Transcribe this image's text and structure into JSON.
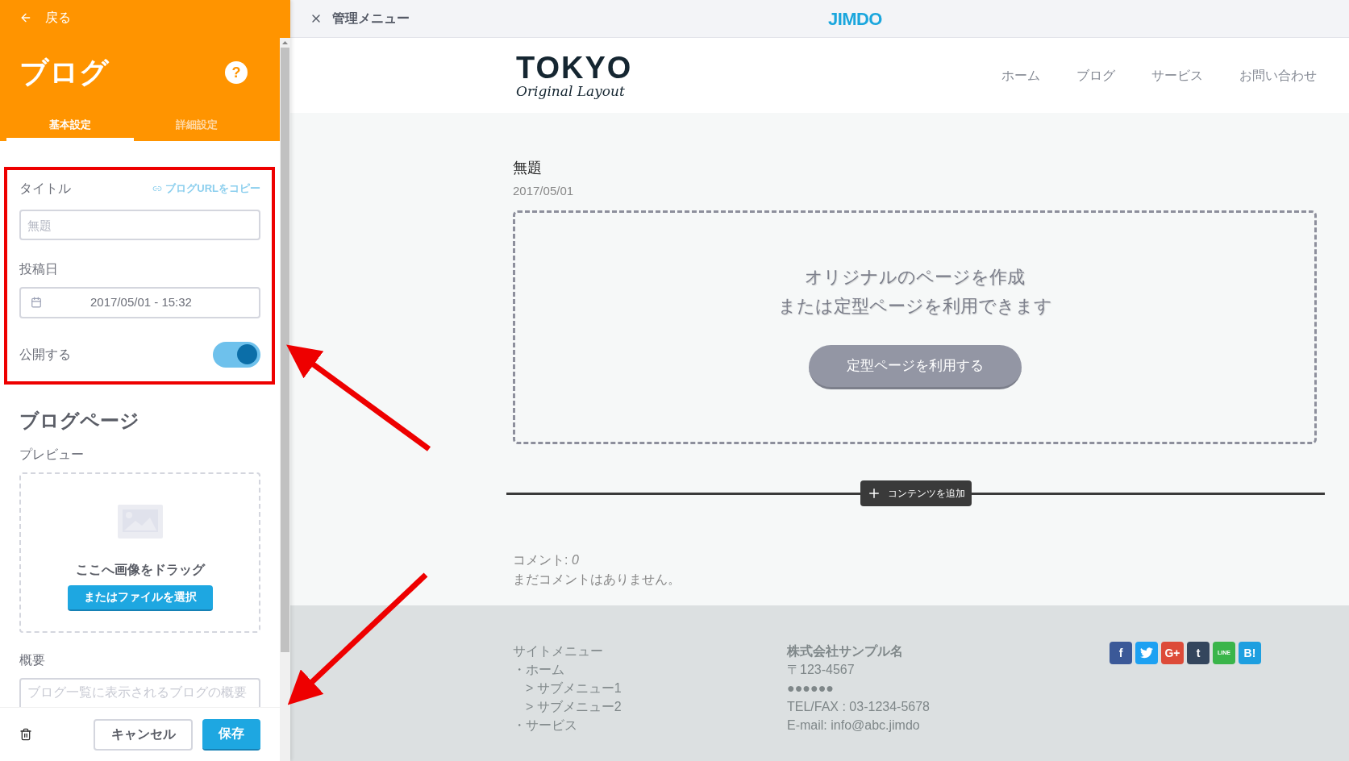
{
  "sidebar": {
    "back": "戻る",
    "title": "ブログ",
    "help": "?",
    "tabs": [
      {
        "label": "基本設定",
        "selected": true
      },
      {
        "label": "詳細設定",
        "selected": false
      }
    ],
    "title_field": {
      "label": "タイトル",
      "copy_link": "ブログURLをコピー",
      "placeholder": "無題"
    },
    "date_field": {
      "label": "投稿日",
      "value": "2017/05/01 - 15:32"
    },
    "publish": {
      "label": "公開する",
      "on": true
    },
    "section_title": "ブログページ",
    "preview": {
      "label": "プレビュー",
      "drop_text": "ここへ画像をドラッグ",
      "button": "またはファイルを選択"
    },
    "summary": {
      "label": "概要",
      "placeholder": "ブログ一覧に表示されるブログの概要"
    },
    "actions": {
      "cancel": "キャンセル",
      "save": "保存"
    }
  },
  "topbar": {
    "title": "管理メニュー",
    "logo": "JIMDO"
  },
  "site": {
    "logo": {
      "title": "TOKYO",
      "subtitle": "Original Layout"
    },
    "nav": [
      "ホーム",
      "ブログ",
      "サービス",
      "お問い合わせ"
    ],
    "post": {
      "title": "無題",
      "date": "2017/05/01"
    },
    "empty_block": {
      "lines": [
        "オリジナルのページを作成",
        "または定型ページを利用できます"
      ],
      "button": "定型ページを利用する"
    },
    "add_content": "コンテンツを追加",
    "comments": {
      "label": "コメント:",
      "count": "0",
      "empty": "まだコメントはありません。"
    },
    "footer": {
      "menu": {
        "title": "サイトメニュー",
        "items": [
          {
            "label": "・ホーム",
            "children": [
              {
                "label": "> サブメニュー1"
              },
              {
                "label": "> サブメニュー2"
              }
            ]
          },
          {
            "label": "・サービス"
          }
        ]
      },
      "company": {
        "name": "株式会社サンプル名",
        "lines": [
          "〒123-4567",
          "●●●●●●",
          "TEL/FAX : 03-1234-5678",
          "E-mail: info@abc.jimdo"
        ]
      },
      "social": [
        {
          "kind": "text",
          "label": "f",
          "color": "#3b5998"
        },
        {
          "kind": "bird",
          "color": "#1da1f2"
        },
        {
          "kind": "text",
          "label": "G+",
          "color": "#dd4b39"
        },
        {
          "kind": "text",
          "label": "t",
          "color": "#34465d"
        },
        {
          "kind": "text",
          "label": "LINE",
          "color": "#3ab54a"
        },
        {
          "kind": "text",
          "label": "B!",
          "color": "#1d9fe0"
        }
      ]
    }
  }
}
